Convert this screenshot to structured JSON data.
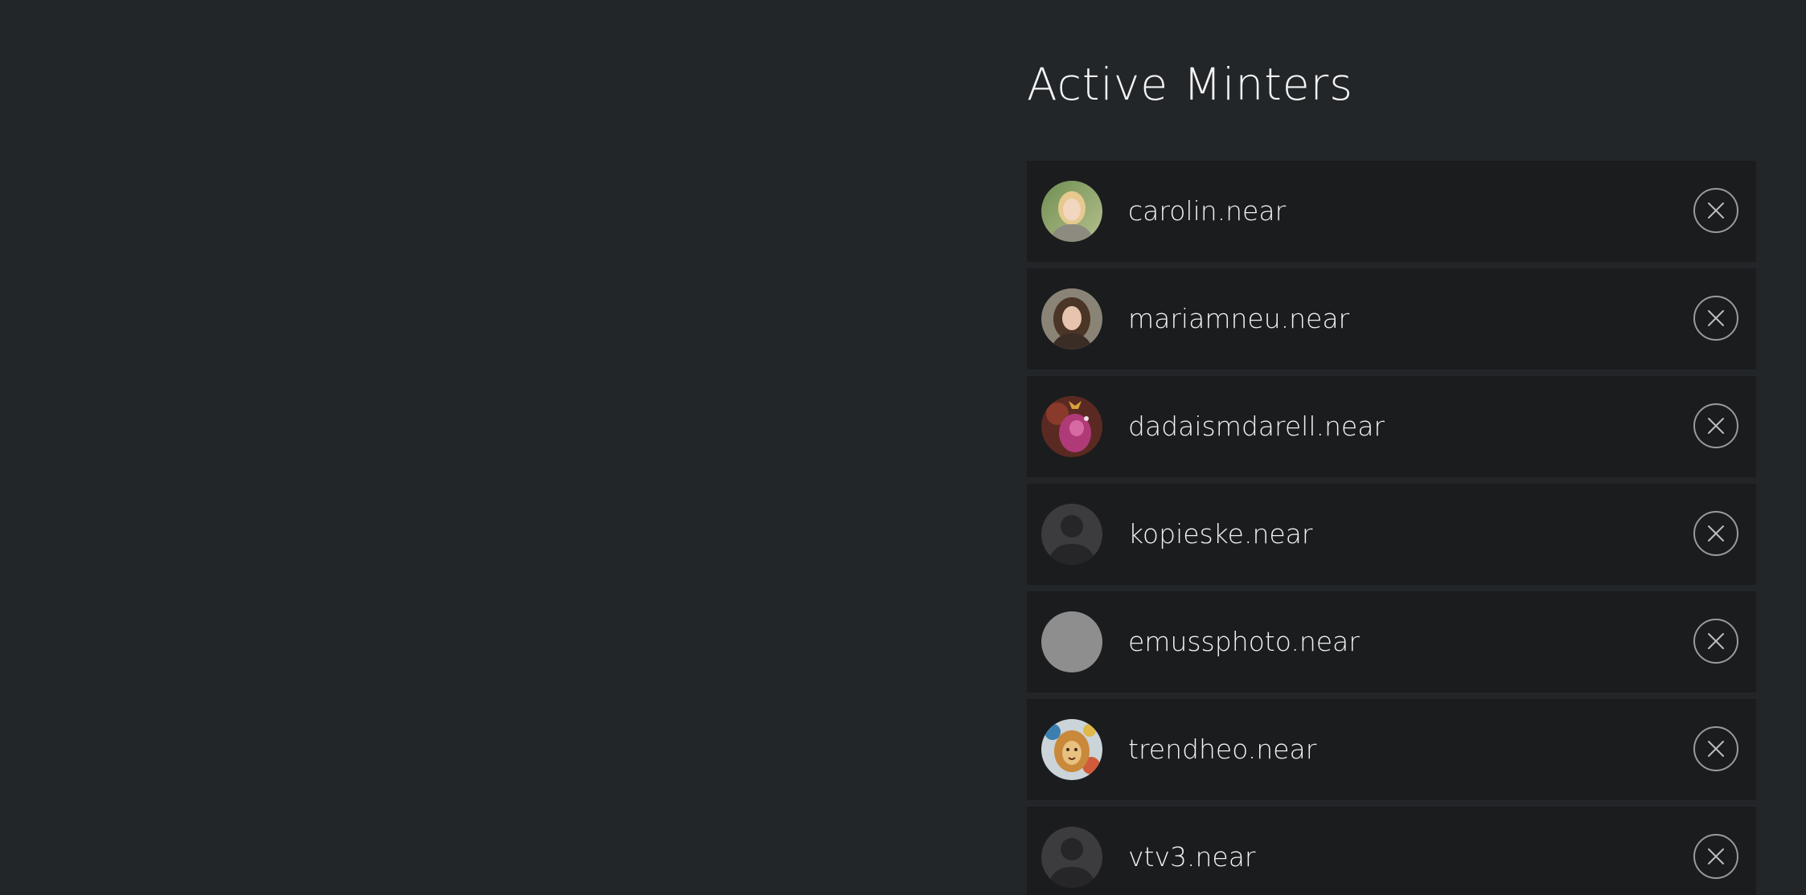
{
  "page": {
    "title": "Active Minters"
  },
  "minters": [
    {
      "name": "carolin.near",
      "avatar": "photo-avatar-blonde-woman"
    },
    {
      "name": "mariamneu.near",
      "avatar": "photo-avatar-curly-hair-woman"
    },
    {
      "name": "dadaismdarell.near",
      "avatar": "artwork-avatar-pink"
    },
    {
      "name": "kopieske.near",
      "avatar": "default-user-avatar"
    },
    {
      "name": "emussphoto.near",
      "avatar": "blank-gray-avatar"
    },
    {
      "name": "trendheo.near",
      "avatar": "artwork-avatar-lion"
    },
    {
      "name": "vtv3.near",
      "avatar": "default-user-avatar"
    }
  ],
  "colors": {
    "background": "#232629",
    "row_background": "#1b1c1e",
    "remove_icon_border": "#9a9a9a"
  }
}
